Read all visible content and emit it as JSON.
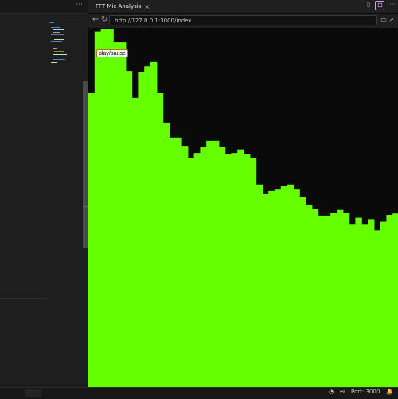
{
  "left_pane": {
    "more_label": "···"
  },
  "tab": {
    "title": "FFT Mic Analysis",
    "close": "×",
    "split_icon": "▯",
    "lock_icon": "⊡",
    "more_label": "···"
  },
  "address": {
    "back": "←",
    "refresh": "↻",
    "url": "http://127.0.0.1:3000/index",
    "device_icon": "▭",
    "pin_icon": "↗"
  },
  "page": {
    "button_label": "play/pause",
    "bar_color": "#66ff00",
    "background_color": "#0a0a0a",
    "spectrum_levels": [
      0.82,
      0.992,
      1.0,
      1.0,
      0.962,
      0.962,
      0.882,
      0.807,
      0.878,
      0.895,
      0.907,
      0.82,
      0.738,
      0.696,
      0.696,
      0.673,
      0.64,
      0.653,
      0.671,
      0.687,
      0.687,
      0.671,
      0.651,
      0.653,
      0.663,
      0.651,
      0.638,
      0.565,
      0.539,
      0.547,
      0.553,
      0.561,
      0.565,
      0.553,
      0.531,
      0.509,
      0.497,
      0.478,
      0.478,
      0.486,
      0.494,
      0.486,
      0.455,
      0.472,
      0.455,
      0.468,
      0.437,
      0.461,
      0.48,
      0.484
    ]
  },
  "status": {
    "ports_icon": "⚯",
    "port": "Port: 3000",
    "bell_icon": "🔔",
    "copilot_icon": "◔"
  }
}
